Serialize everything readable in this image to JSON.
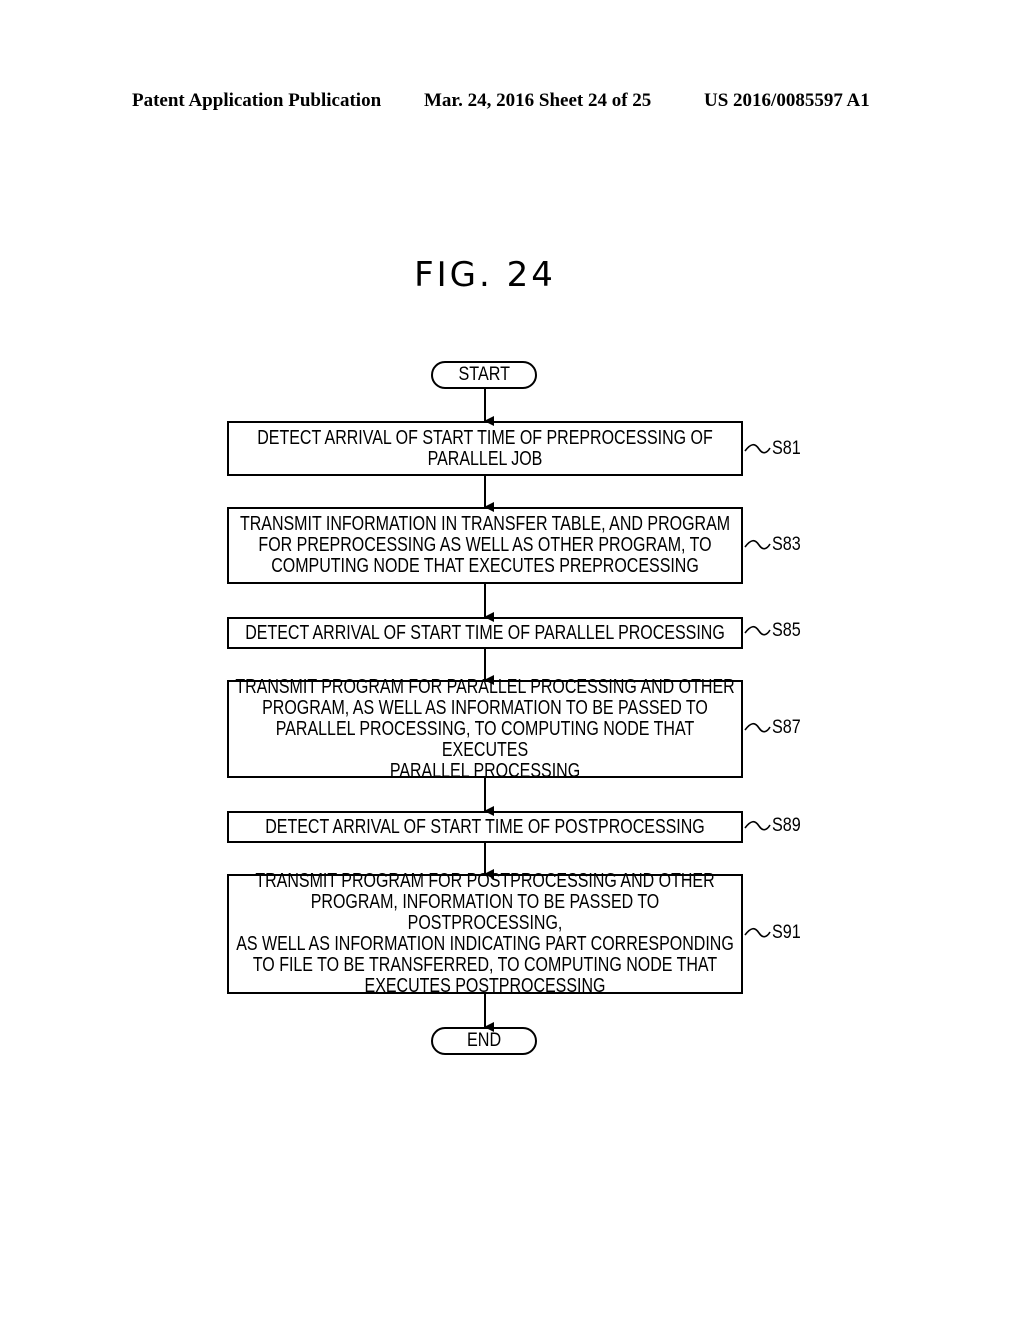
{
  "header": {
    "left": "Patent Application Publication",
    "middle": "Mar. 24, 2016  Sheet 24 of 25",
    "right": "US 2016/0085597 A1"
  },
  "figure": {
    "title": "FIG. 24",
    "start_label": "START",
    "end_label": "END",
    "steps": [
      {
        "id": "S81",
        "text": "DETECT ARRIVAL OF START TIME OF PREPROCESSING OF\nPARALLEL JOB"
      },
      {
        "id": "S83",
        "text": "TRANSMIT INFORMATION IN TRANSFER TABLE, AND PROGRAM\nFOR PREPROCESSING AS WELL AS OTHER PROGRAM, TO\nCOMPUTING NODE THAT EXECUTES PREPROCESSING"
      },
      {
        "id": "S85",
        "text": "DETECT ARRIVAL OF START TIME OF PARALLEL PROCESSING"
      },
      {
        "id": "S87",
        "text": "TRANSMIT PROGRAM FOR PARALLEL PROCESSING AND OTHER\nPROGRAM, AS WELL AS INFORMATION TO BE PASSED TO\nPARALLEL PROCESSING, TO COMPUTING NODE THAT EXECUTES\nPARALLEL PROCESSING"
      },
      {
        "id": "S89",
        "text": "DETECT ARRIVAL OF START TIME OF POSTPROCESSING"
      },
      {
        "id": "S91",
        "text": "TRANSMIT PROGRAM FOR POSTPROCESSING AND OTHER\nPROGRAM, INFORMATION TO BE PASSED TO POSTPROCESSING,\nAS WELL AS INFORMATION INDICATING PART CORRESPONDING\nTO FILE TO BE TRANSFERRED, TO COMPUTING NODE THAT\nEXECUTES POSTPROCESSING"
      }
    ]
  }
}
